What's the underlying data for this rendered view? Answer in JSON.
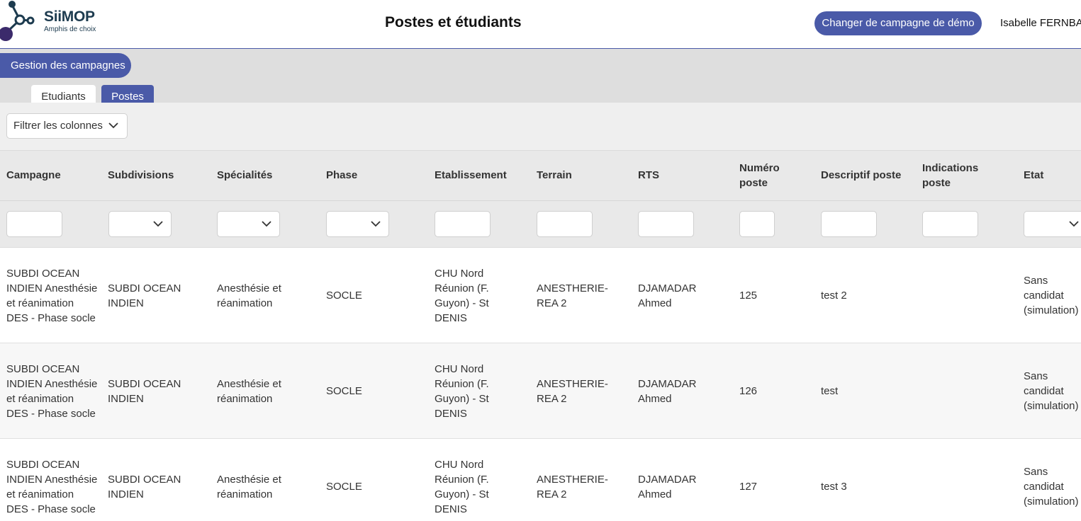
{
  "header": {
    "logo_name": "SiiMOP",
    "logo_tagline": "Amphis de choix",
    "page_title": "Postes et étudiants",
    "campaign_button": "Changer de campagne de démo",
    "user_name": "Isabelle FERNBAC"
  },
  "nav": {
    "manage_button": "Gestion des campagnes",
    "tabs": [
      {
        "label": "Etudiants",
        "active": false
      },
      {
        "label": "Postes",
        "active": true
      }
    ]
  },
  "filter": {
    "columns_filter_label": "Filtrer les colonnes"
  },
  "table": {
    "columns": [
      {
        "label": "Campagne",
        "filter": "text"
      },
      {
        "label": "Subdivisions",
        "filter": "select"
      },
      {
        "label": "Spécialités",
        "filter": "select"
      },
      {
        "label": "Phase",
        "filter": "select"
      },
      {
        "label": "Etablissement",
        "filter": "text"
      },
      {
        "label": "Terrain",
        "filter": "text"
      },
      {
        "label": "RTS",
        "filter": "text"
      },
      {
        "label": "Numéro poste",
        "filter": "text"
      },
      {
        "label": "Descriptif poste",
        "filter": "text"
      },
      {
        "label": "Indications poste",
        "filter": "text"
      },
      {
        "label": "Etat",
        "filter": "select"
      }
    ],
    "rows": [
      {
        "campagne": "SUBDI OCEAN INDIEN Anesthésie et réanimation DES - Phase socle",
        "subdivisions": "SUBDI OCEAN INDIEN",
        "specialites": "Anesthésie et réanimation",
        "phase": "SOCLE",
        "etablissement": "CHU Nord Réunion (F. Guyon) - St DENIS",
        "terrain": "ANESTHERIE-REA 2",
        "rts": "DJAMADAR Ahmed",
        "numero": "125",
        "descriptif": "test 2",
        "indications": "",
        "etat": "Sans candidat (simulation)"
      },
      {
        "campagne": "SUBDI OCEAN INDIEN Anesthésie et réanimation DES - Phase socle",
        "subdivisions": "SUBDI OCEAN INDIEN",
        "specialites": "Anesthésie et réanimation",
        "phase": "SOCLE",
        "etablissement": "CHU Nord Réunion (F. Guyon) - St DENIS",
        "terrain": "ANESTHERIE-REA 2",
        "rts": "DJAMADAR Ahmed",
        "numero": "126",
        "descriptif": "test",
        "indications": "",
        "etat": "Sans candidat (simulation)"
      },
      {
        "campagne": "SUBDI OCEAN INDIEN Anesthésie et réanimation DES - Phase socle",
        "subdivisions": "SUBDI OCEAN INDIEN",
        "specialites": "Anesthésie et réanimation",
        "phase": "SOCLE",
        "etablissement": "CHU Nord Réunion (F. Guyon) - St DENIS",
        "terrain": "ANESTHERIE-REA 2",
        "rts": "DJAMADAR Ahmed",
        "numero": "127",
        "descriptif": "test 3",
        "indications": "",
        "etat": "Sans candidat (simulation)"
      }
    ]
  },
  "colors": {
    "accent": "#4a5aa8",
    "band": "#dedede",
    "header_row": "#e9e9e9",
    "logo_dark": "#1d3b4f",
    "logo_purple": "#3b2a6b"
  },
  "icons": {
    "logo": "molecule-logo-icon",
    "dropdown": "chevron-down-icon"
  }
}
